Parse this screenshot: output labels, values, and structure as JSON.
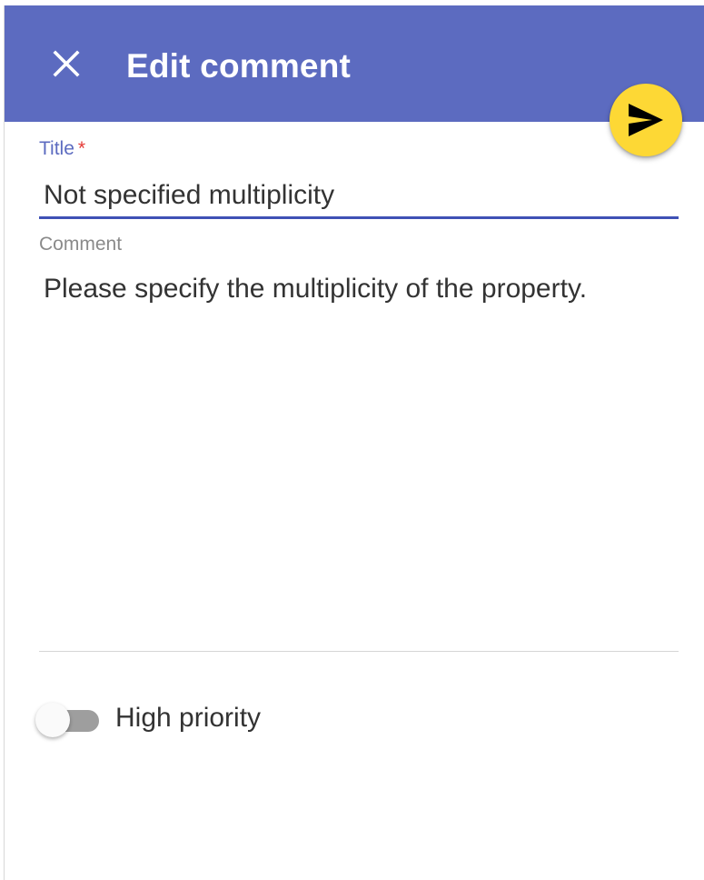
{
  "dialog": {
    "title": "Edit comment",
    "close_icon": "close-icon",
    "send_icon": "send-icon",
    "header_color": "#5c6bc0",
    "fab_color": "#fdd835"
  },
  "form": {
    "title_label": "Title",
    "title_required_marker": "*",
    "title_value": "Not specified multiplicity",
    "comment_label": "Comment",
    "comment_value": "Please specify the multiplicity of the property.",
    "priority_label": "High priority",
    "priority_enabled": false
  }
}
